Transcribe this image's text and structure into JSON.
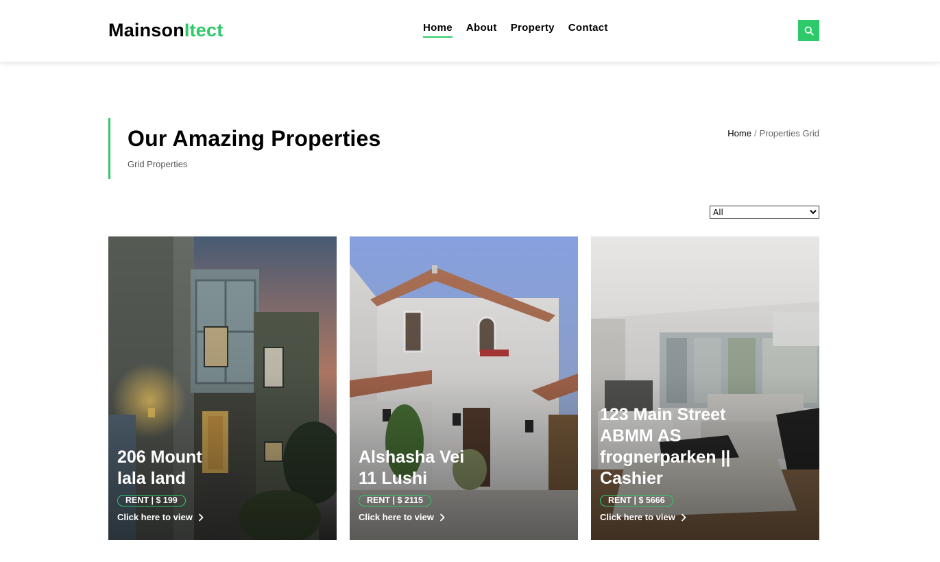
{
  "brand": {
    "part1": "Mainson",
    "part2": "Itect",
    "accent_color": "#2eca6a"
  },
  "nav": {
    "items": [
      "Home",
      "About",
      "Property",
      "Contact"
    ],
    "active": "Home"
  },
  "search": {
    "icon": "search-icon"
  },
  "intro": {
    "title": "Our Amazing Properties",
    "subtitle": "Grid Properties"
  },
  "breadcrumb": {
    "home": "Home",
    "separator": "/",
    "current": "Properties Grid"
  },
  "filter": {
    "selected": "All"
  },
  "properties": [
    {
      "title_line1": "206 Mount",
      "title_line2": "lala land",
      "title_line3": "",
      "title_line4": "",
      "price": "RENT | $ 199",
      "link": "Click here to view"
    },
    {
      "title_line1": "Alshasha Vei",
      "title_line2": "11 Lushi",
      "title_line3": "",
      "title_line4": "",
      "price": "RENT | $ 2115",
      "link": "Click here to view"
    },
    {
      "title_line1": "123 Main Street",
      "title_line2": "ABMM AS",
      "title_line3": "frognerparken ||",
      "title_line4": "Cashier",
      "price": "RENT | $ 5666",
      "link": "Click here to view"
    }
  ]
}
